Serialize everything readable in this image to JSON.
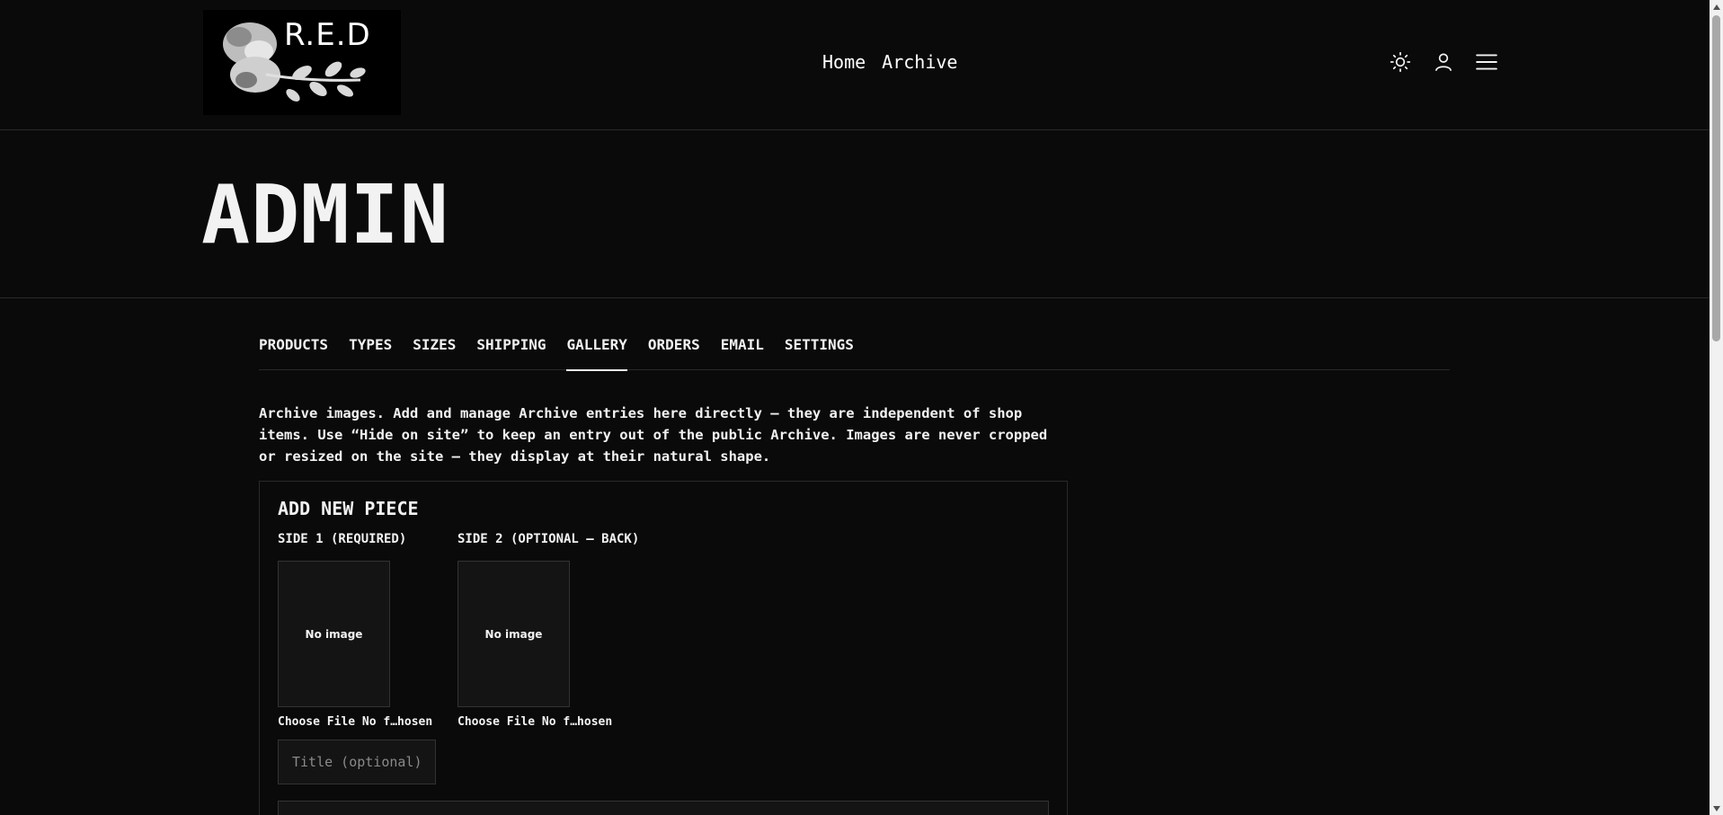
{
  "header": {
    "logo_text": "R.E.D",
    "nav": [
      {
        "label": "Home"
      },
      {
        "label": "Archive"
      }
    ],
    "icons": [
      "sun-icon",
      "user-icon",
      "menu-icon"
    ]
  },
  "page": {
    "title": "ADMIN"
  },
  "tabs": [
    {
      "label": "PRODUCTS",
      "active": false
    },
    {
      "label": "TYPES",
      "active": false
    },
    {
      "label": "SIZES",
      "active": false
    },
    {
      "label": "SHIPPING",
      "active": false
    },
    {
      "label": "GALLERY",
      "active": true
    },
    {
      "label": "ORDERS",
      "active": false
    },
    {
      "label": "EMAIL",
      "active": false
    },
    {
      "label": "SETTINGS",
      "active": false
    }
  ],
  "gallery": {
    "intro": "Archive images. Add and manage Archive entries here directly — they are independent of shop items. Use “Hide on site” to keep an entry out of the public Archive. Images are never cropped or resized on the site — they display at their natural shape.",
    "add_piece": {
      "title": "ADD NEW PIECE",
      "side1": {
        "label": "SIDE 1 (REQUIRED)",
        "placeholder_text": "No image",
        "file_button": "Choose File",
        "file_status": "No f…hosen"
      },
      "side2": {
        "label": "SIDE 2 (OPTIONAL — BACK)",
        "placeholder_text": "No image",
        "file_button": "Choose File",
        "file_status": "No f…hosen"
      },
      "title_input": {
        "value": "",
        "placeholder": "Title (optional)"
      }
    }
  },
  "colors": {
    "background": "#0a0a0a",
    "text": "#f2f2f2",
    "border": "#2a2a2a",
    "field_bg": "#141414"
  }
}
